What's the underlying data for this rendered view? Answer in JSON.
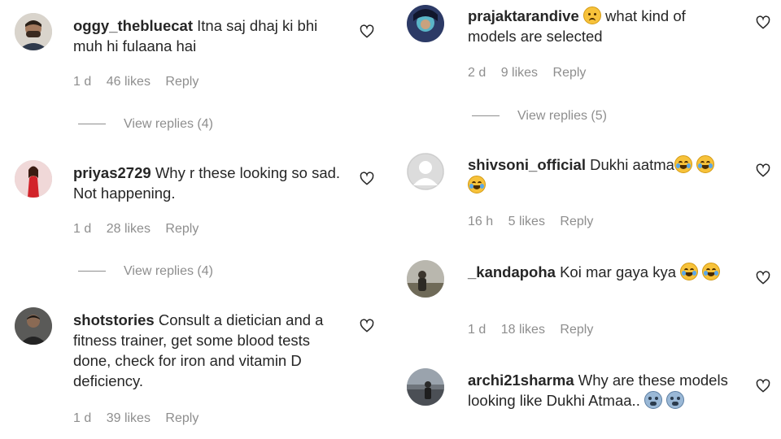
{
  "left": [
    {
      "user": "oggy_thebluecat",
      "text": "Itna saj dhaj ki bhi muh hi fulaana hai",
      "time": "1 d",
      "likes": "46 likes",
      "reply": "Reply",
      "views": "View replies (4)"
    },
    {
      "user": "priyas2729",
      "text": "Why r these looking so sad. Not happening.",
      "time": "1 d",
      "likes": "28 likes",
      "reply": "Reply",
      "views": "View replies (4)"
    },
    {
      "user": "shotstories",
      "text": "Consult a dietician and a fitness trainer, get some blood tests done, check for iron and vitamin D deficiency.",
      "time": "1 d",
      "likes": "39 likes",
      "reply": "Reply"
    }
  ],
  "right": [
    {
      "user": "prajaktarandive",
      "text": "what kind of models are selected",
      "time": "2 d",
      "likes": "9 likes",
      "reply": "Reply",
      "views": "View replies (5)"
    },
    {
      "user": "shivsoni_official",
      "text": "Dukhi aatma",
      "time": "16 h",
      "likes": "5 likes",
      "reply": "Reply"
    },
    {
      "user": "_kandapoha",
      "text": "Koi mar gaya kya",
      "time": "1 d",
      "likes": "18 likes",
      "reply": "Reply"
    },
    {
      "user": "archi21sharma",
      "text": "Why are these models looking like Dukhi Atmaa..",
      "time": "",
      "likes": "",
      "reply": ""
    }
  ]
}
